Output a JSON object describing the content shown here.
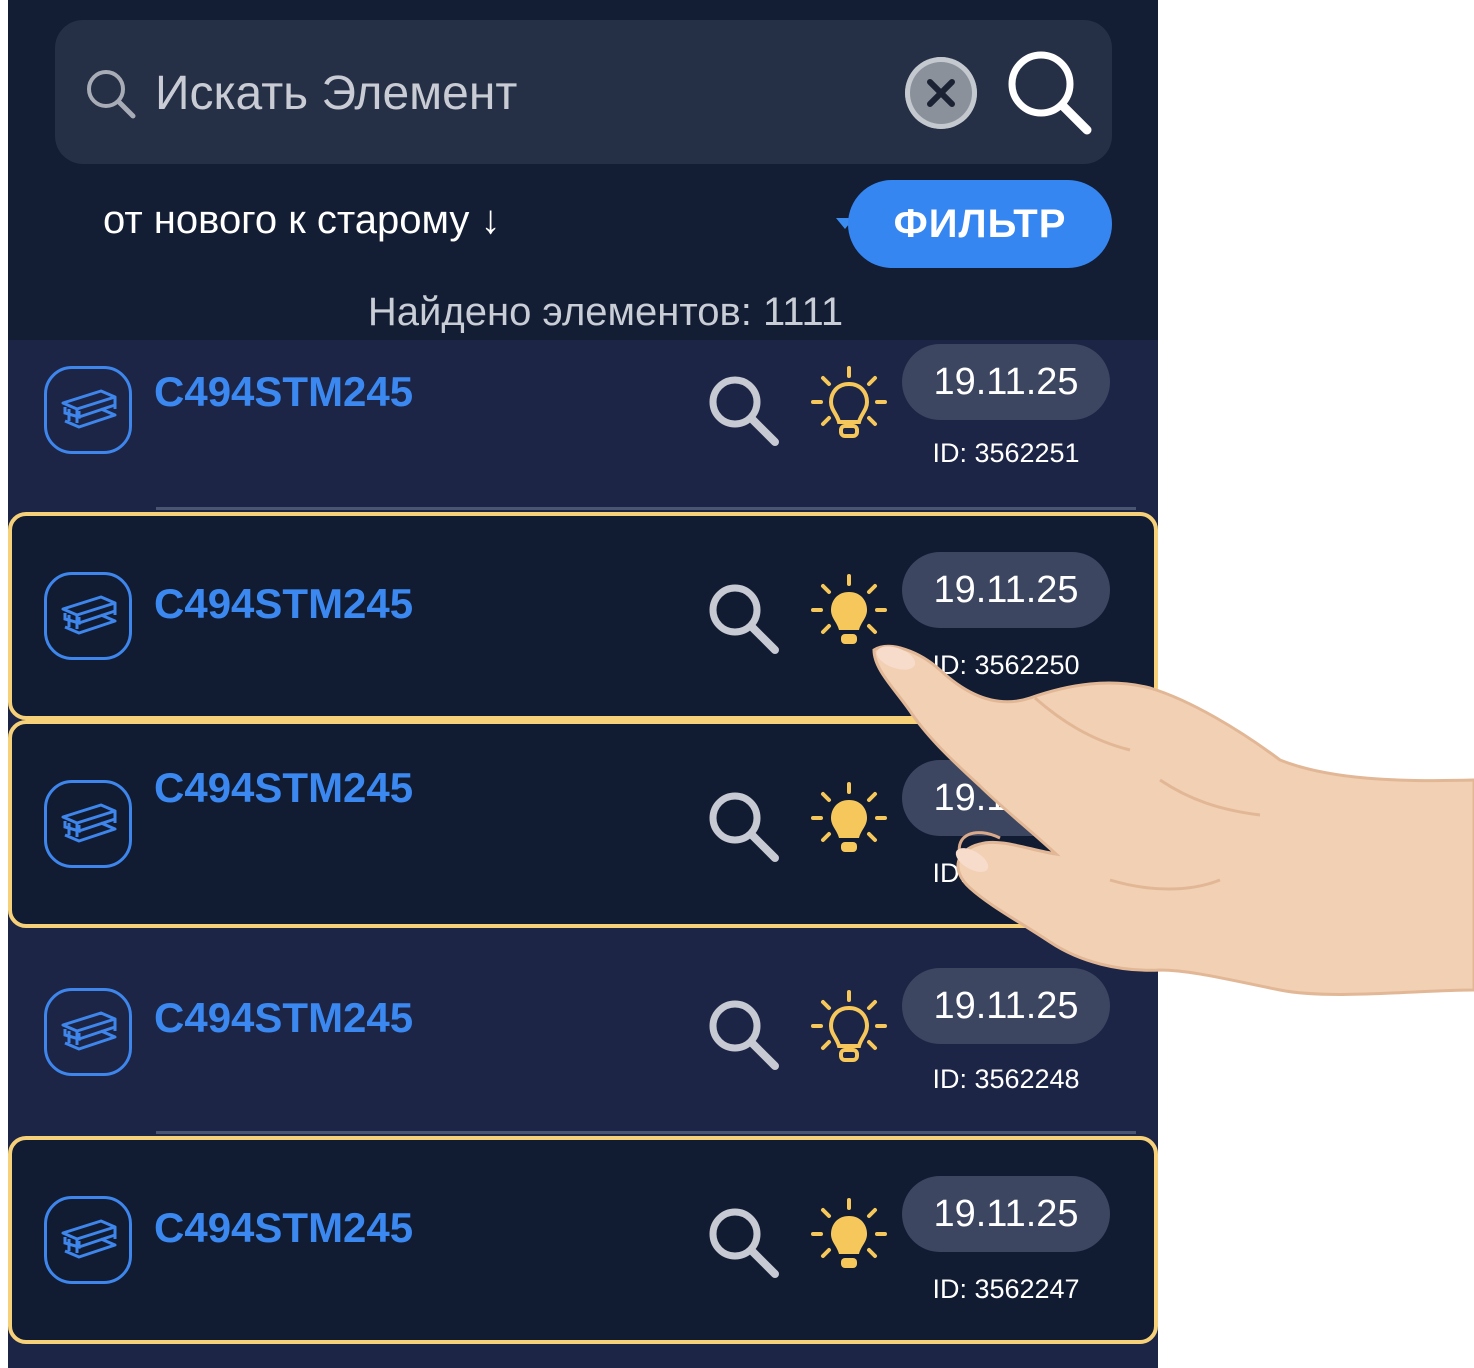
{
  "search": {
    "placeholder": "Искать Элемент",
    "value": "",
    "icons": [
      "search-icon",
      "clear-icon",
      "search-submit-icon"
    ]
  },
  "sort": {
    "label": "от нового к старому ↓"
  },
  "filter": {
    "label": "ФИЛЬТР"
  },
  "found": {
    "label": "Найдено элементов: 1111"
  },
  "colors": {
    "background": "#131d33",
    "list_background": "#1c2546",
    "accent": "#3686f2",
    "selected_border": "#f6d17a",
    "bulb_on": "#f6c75a"
  },
  "items": [
    {
      "name": "C494STM245",
      "date": "19.11.25",
      "id": "ID: 3562251",
      "selected": false,
      "bulb": "off"
    },
    {
      "name": "C494STM245",
      "date": "19.11.25",
      "id": "ID: 3562250",
      "selected": true,
      "bulb": "on"
    },
    {
      "name": "C494STM245",
      "date": "19.11.25",
      "id": "ID: 3562249",
      "selected": true,
      "bulb": "on"
    },
    {
      "name": "C494STM245",
      "date": "19.11.25",
      "id": "ID: 3562248",
      "selected": false,
      "bulb": "off"
    },
    {
      "name": "C494STM245",
      "date": "19.11.25",
      "id": "ID: 3562247",
      "selected": true,
      "bulb": "on"
    }
  ]
}
